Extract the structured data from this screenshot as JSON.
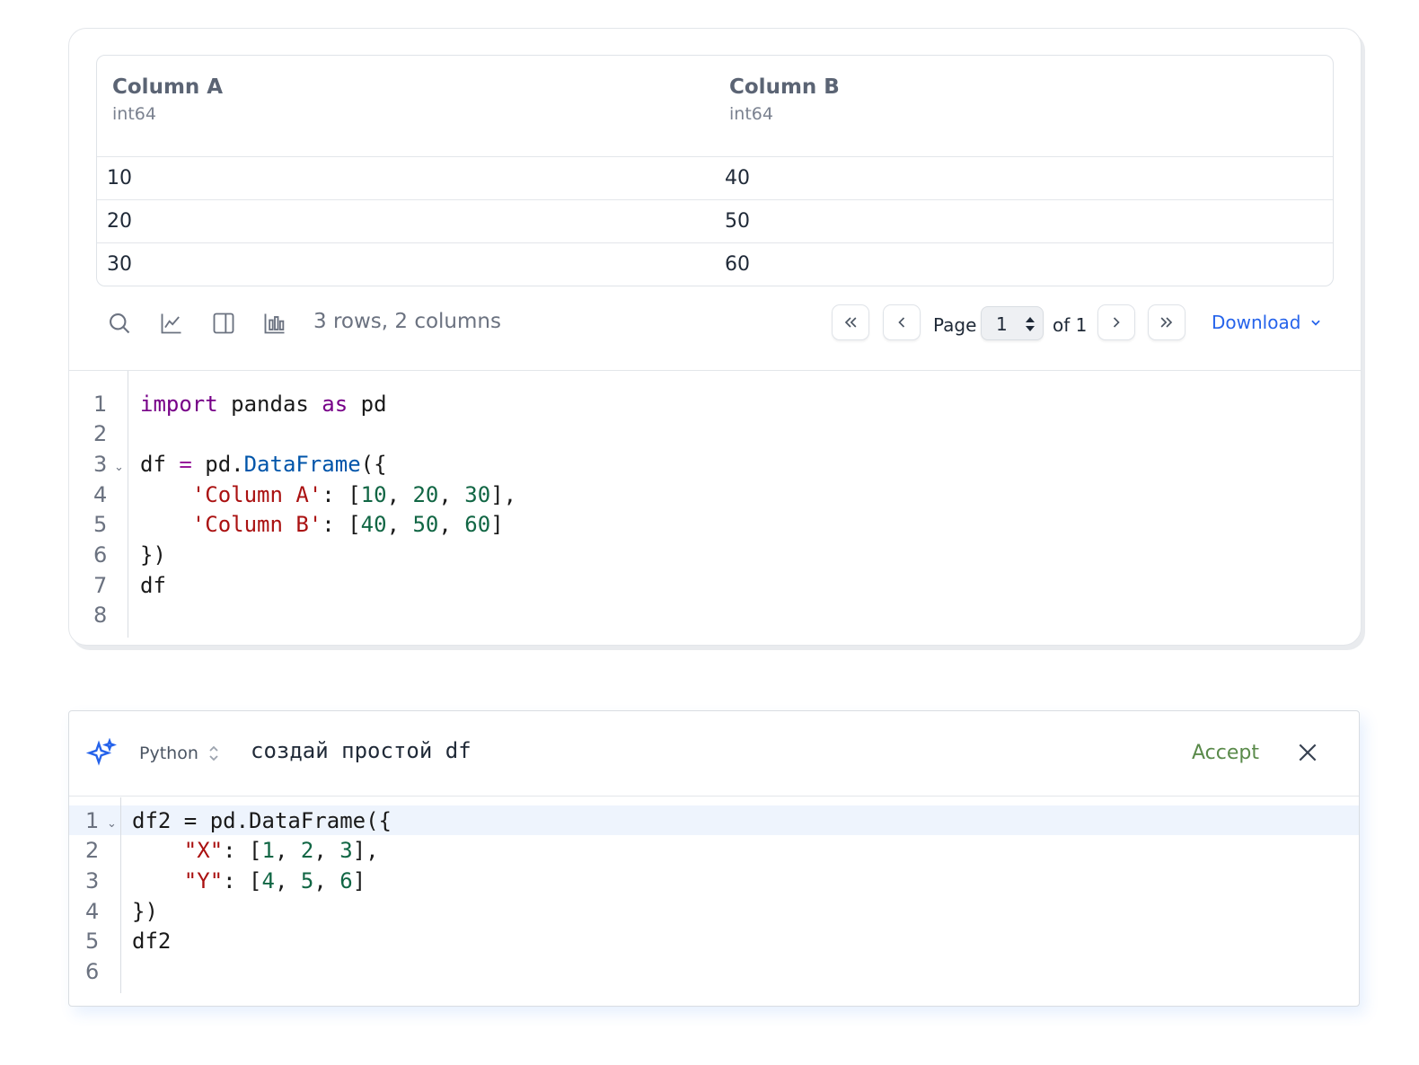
{
  "table": {
    "columns": [
      {
        "name": "Column A",
        "dtype": "int64"
      },
      {
        "name": "Column B",
        "dtype": "int64"
      }
    ],
    "rows": [
      [
        "10",
        "40"
      ],
      [
        "20",
        "50"
      ],
      [
        "30",
        "60"
      ]
    ]
  },
  "toolbar": {
    "row_count": "3 rows, 2 columns",
    "page_label": "Page",
    "page_value": "1",
    "of_label": "of 1",
    "download_label": "Download",
    "icons": [
      "search-icon",
      "line-chart-icon",
      "panel-icon",
      "bar-chart-icon"
    ]
  },
  "editor1": {
    "line_numbers": [
      "1",
      "2",
      "3",
      "4",
      "5",
      "6",
      "7",
      "8"
    ],
    "lines": [
      "import pandas as pd",
      "",
      "df = pd.DataFrame({",
      "    'Column A': [10, 20, 30],",
      "    'Column B': [40, 50, 60]",
      "})",
      "df",
      ""
    ]
  },
  "ai": {
    "language": "Python",
    "prompt": "создай простой df",
    "accept_label": "Accept",
    "line_numbers": [
      "1",
      "2",
      "3",
      "4",
      "5",
      "6"
    ],
    "lines": [
      "df2 = pd.DataFrame({",
      "    \"X\": [1, 2, 3],",
      "    \"Y\": [4, 5, 6]",
      "})",
      "df2",
      ""
    ]
  },
  "colors": {
    "accent": "#2563eb",
    "accept": "#5a8a4a",
    "keyword": "#770088",
    "string": "#aa1111",
    "number": "#116644"
  }
}
